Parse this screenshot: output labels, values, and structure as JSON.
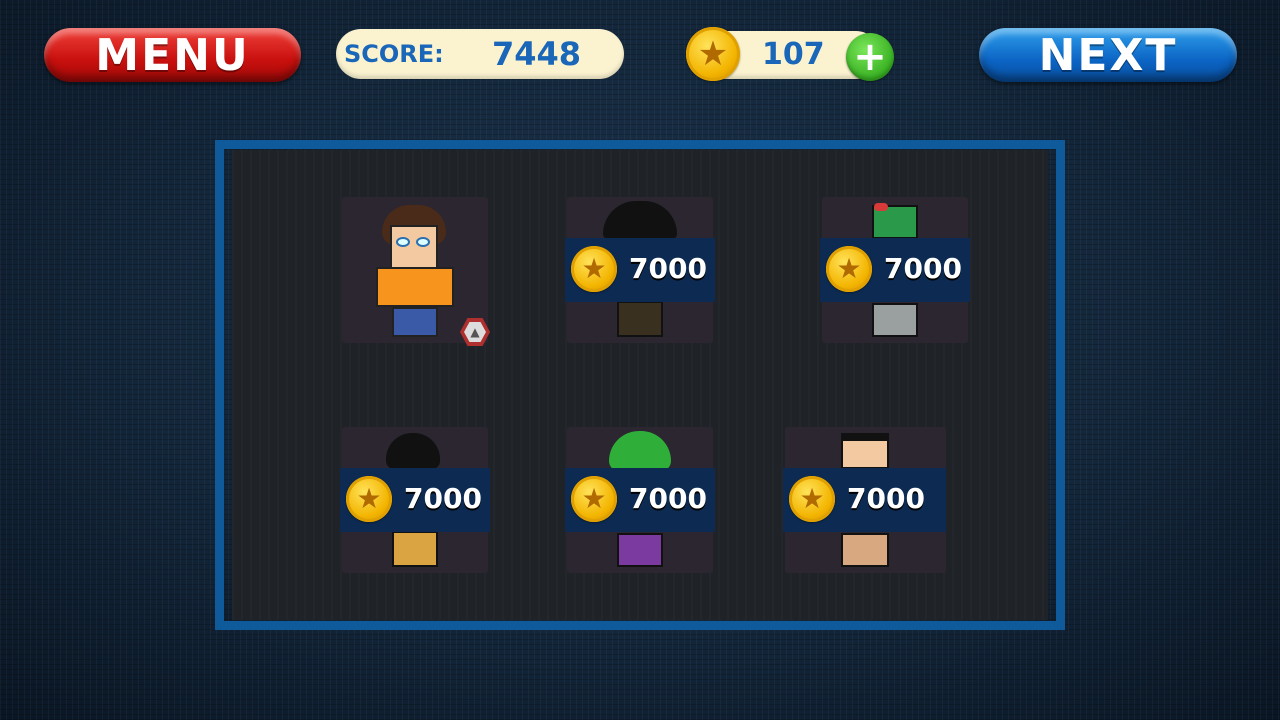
{
  "header": {
    "menu_label": "MENU",
    "next_label": "NEXT",
    "score_label": "SCORE:",
    "score_value": "7448",
    "coins_value": "107",
    "add_coins_icon": "plus-icon",
    "coin_icon": "star-coin-icon"
  },
  "characters": [
    {
      "name": "curly-hair-guy",
      "state": "owned"
    },
    {
      "name": "pirate-hat-character",
      "price": "7000",
      "state": "locked"
    },
    {
      "name": "zombie-character",
      "price": "7000",
      "state": "locked"
    },
    {
      "name": "caveman-character",
      "price": "7000",
      "state": "locked"
    },
    {
      "name": "joker-character",
      "price": "7000",
      "state": "locked"
    },
    {
      "name": "boxer-character",
      "price": "7000",
      "state": "locked"
    }
  ],
  "colors": {
    "menu_button": "#d0201a",
    "next_button": "#0c64c4",
    "panel_border": "#0f5a9a",
    "price_tag": "#0d2b52",
    "score_text": "#1a66b8"
  }
}
